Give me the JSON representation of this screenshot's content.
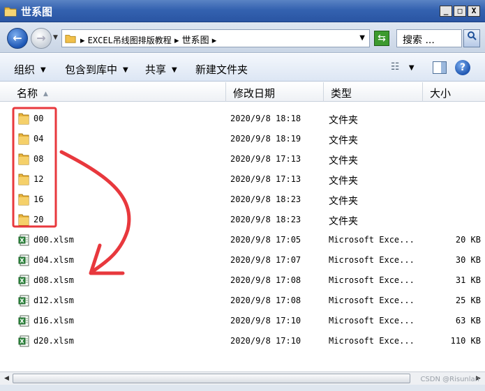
{
  "window": {
    "title": "世系图",
    "min_label": "_",
    "max_label": "□",
    "close_label": "X"
  },
  "address": {
    "breadcrumb_sep": "▸",
    "crumbs": [
      "EXCEL吊线图排版教程",
      "世系图"
    ],
    "search_placeholder": "搜索 ..."
  },
  "toolbar": {
    "organize": "组织",
    "include_in_library": "包含到库中",
    "share": "共享",
    "new_folder": "新建文件夹"
  },
  "columns": {
    "name": "名称",
    "date": "修改日期",
    "type": "类型",
    "size": "大小"
  },
  "files": [
    {
      "name": "00",
      "date": "2020/9/8 18:18",
      "type": "文件夹",
      "size": "",
      "icon": "folder-icon"
    },
    {
      "name": "04",
      "date": "2020/9/8 18:19",
      "type": "文件夹",
      "size": "",
      "icon": "folder-icon"
    },
    {
      "name": "08",
      "date": "2020/9/8 17:13",
      "type": "文件夹",
      "size": "",
      "icon": "folder-icon"
    },
    {
      "name": "12",
      "date": "2020/9/8 17:13",
      "type": "文件夹",
      "size": "",
      "icon": "folder-icon"
    },
    {
      "name": "16",
      "date": "2020/9/8 18:23",
      "type": "文件夹",
      "size": "",
      "icon": "folder-icon"
    },
    {
      "name": "20",
      "date": "2020/9/8 18:23",
      "type": "文件夹",
      "size": "",
      "icon": "folder-icon"
    },
    {
      "name": "d00.xlsm",
      "date": "2020/9/8 17:05",
      "type": "Microsoft Exce...",
      "size": "20 KB",
      "icon": "excel-file-icon"
    },
    {
      "name": "d04.xlsm",
      "date": "2020/9/8 17:07",
      "type": "Microsoft Exce...",
      "size": "30 KB",
      "icon": "excel-file-icon"
    },
    {
      "name": "d08.xlsm",
      "date": "2020/9/8 17:08",
      "type": "Microsoft Exce...",
      "size": "31 KB",
      "icon": "excel-file-icon"
    },
    {
      "name": "d12.xlsm",
      "date": "2020/9/8 17:08",
      "type": "Microsoft Exce...",
      "size": "25 KB",
      "icon": "excel-file-icon"
    },
    {
      "name": "d16.xlsm",
      "date": "2020/9/8 17:10",
      "type": "Microsoft Exce...",
      "size": "63 KB",
      "icon": "excel-file-icon"
    },
    {
      "name": "d20.xlsm",
      "date": "2020/9/8 17:10",
      "type": "Microsoft Exce...",
      "size": "110 KB",
      "icon": "excel-file-icon"
    }
  ],
  "watermark": "CSDN @Risunlan",
  "colors": {
    "annotation": "#e8383d",
    "title_bar": "#3462b0",
    "folder": "#f2c04a",
    "excel": "#2e8b3e"
  }
}
